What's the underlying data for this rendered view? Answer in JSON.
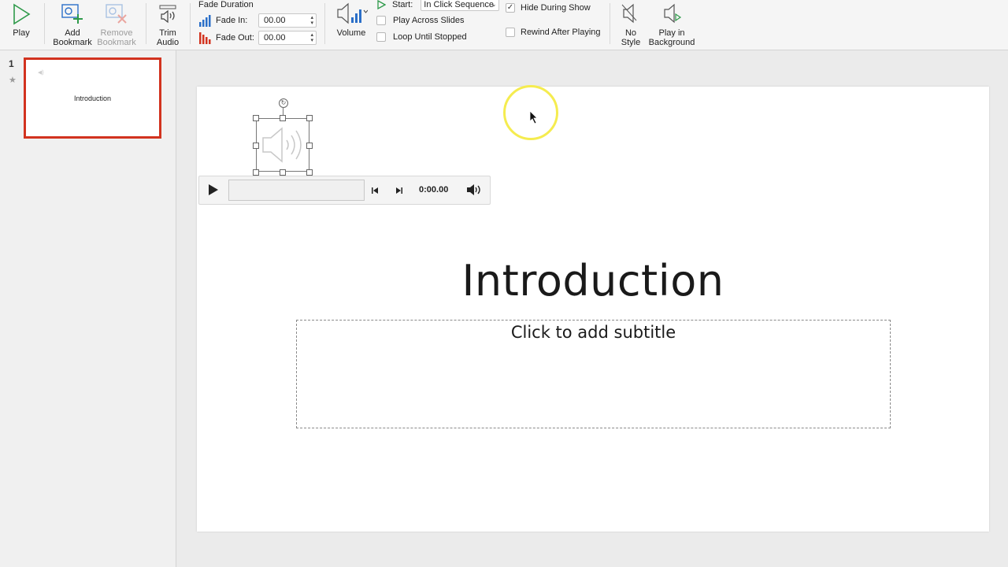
{
  "ribbon": {
    "play_label": "Play",
    "add_bookmark_label": "Add Bookmark",
    "remove_bookmark_label": "Remove Bookmark",
    "trim_audio_label": "Trim Audio",
    "fade_duration_title": "Fade Duration",
    "fade_in_label": "Fade In:",
    "fade_in_value": "00.00",
    "fade_out_label": "Fade Out:",
    "fade_out_value": "00.00",
    "volume_label": "Volume",
    "start_label": "Start:",
    "start_value": "In Click Sequence",
    "play_across_slides_label": "Play Across Slides",
    "play_across_slides_checked": false,
    "loop_until_stopped_label": "Loop Until Stopped",
    "loop_until_stopped_checked": false,
    "hide_during_show_label": "Hide During Show",
    "hide_during_show_checked": true,
    "rewind_after_playing_label": "Rewind After Playing",
    "rewind_after_playing_checked": false,
    "no_style_label": "No Style",
    "play_in_background_label": "Play in Background"
  },
  "slides_panel": {
    "slides": [
      {
        "number": "1",
        "title": "Introduction"
      }
    ]
  },
  "slide": {
    "title": "Introduction",
    "subtitle_placeholder": "Click to add subtitle"
  },
  "player": {
    "time": "0:00.00"
  },
  "colors": {
    "selection_border": "#d2331f",
    "cursor_highlight": "#f5ec4f",
    "accent_green": "#2e9a4a",
    "accent_blue": "#2b6fc8",
    "accent_red": "#d2331f"
  }
}
